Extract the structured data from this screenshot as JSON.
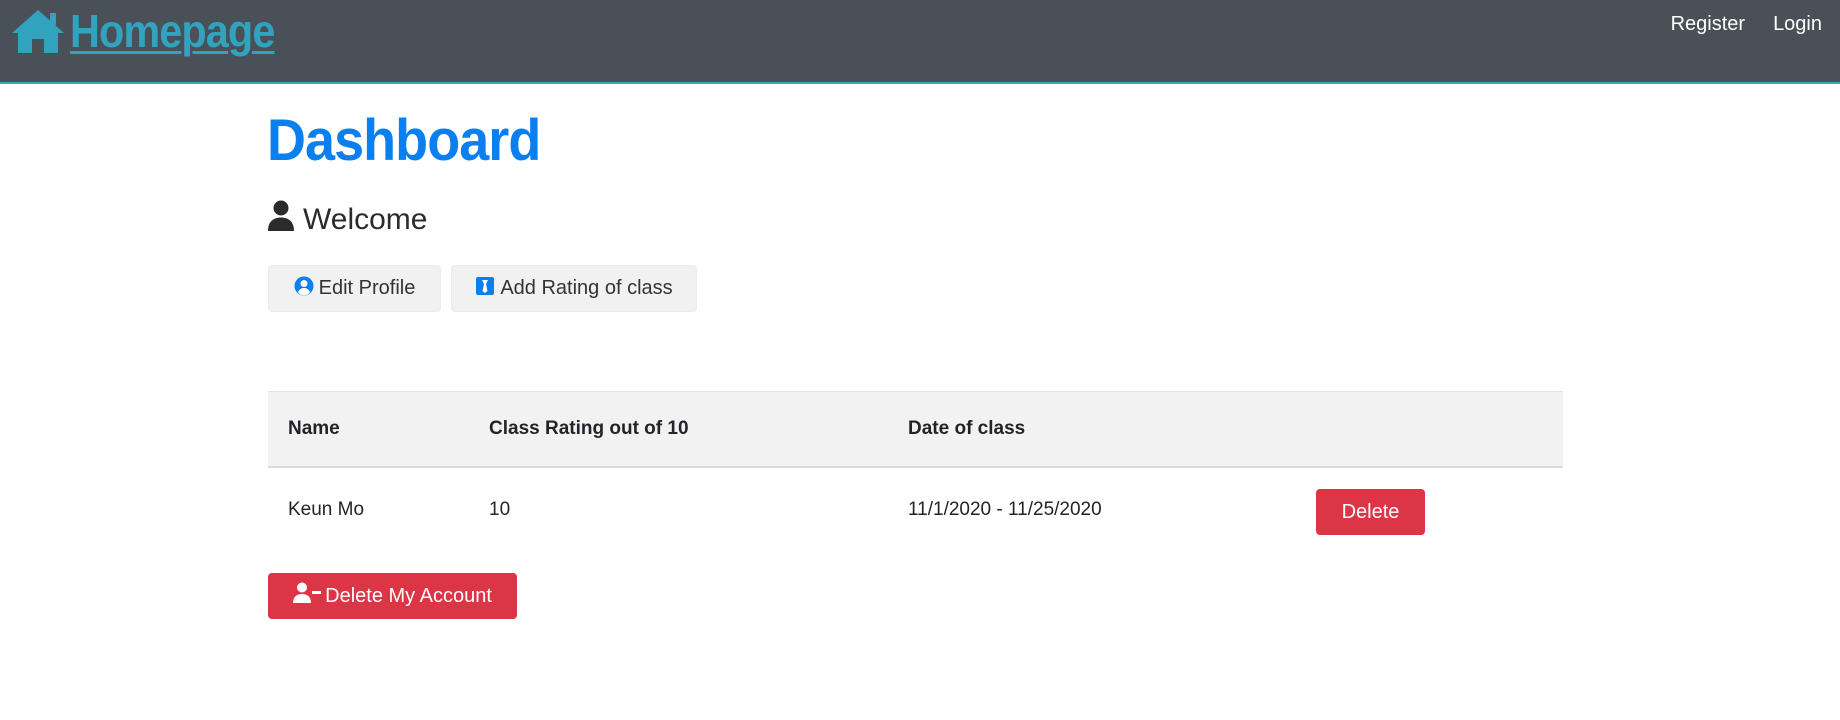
{
  "navbar": {
    "brand_label": " Homepage",
    "brand_icon": "home-icon",
    "links": [
      {
        "label": "Register"
      },
      {
        "label": "Login"
      }
    ]
  },
  "main": {
    "title": "Dashboard",
    "welcome_text": "Welcome",
    "welcome_icon": "user-icon",
    "buttons": {
      "edit_profile_label": "Edit Profile",
      "add_rating_label": "Add Rating of class"
    },
    "table": {
      "headers": [
        "Name",
        "Class Rating out of 10",
        "Date of class"
      ],
      "rows": [
        {
          "name": "Keun Mo",
          "rating": "10",
          "date": "11/1/2020 - 11/25/2020",
          "action_label": "Delete"
        }
      ]
    },
    "delete_account_label": "Delete My Account"
  },
  "colors": {
    "navbar_bg": "#495057",
    "brand": "#31a3bf",
    "title": "#0a7ff0",
    "danger": "#dc3545",
    "button_light": "#f1f1f1"
  }
}
